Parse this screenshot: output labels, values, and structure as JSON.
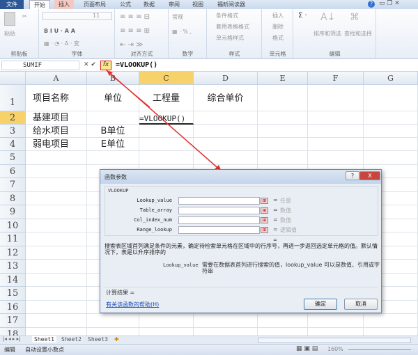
{
  "ribbon_tabs": [
    "文件",
    "开始",
    "插入",
    "页面布局",
    "公式",
    "数据",
    "审阅",
    "视图",
    "福昕阅读器"
  ],
  "ribbon": {
    "clipboard": {
      "paste": "粘贴",
      "label": "剪贴板"
    },
    "font": {
      "size": "11",
      "label": "字体"
    },
    "alignment": {
      "label": "对齐方式"
    },
    "number": {
      "format": "常规",
      "label": "数字"
    },
    "styles": {
      "cond": "条件格式",
      "table": "套用表格格式",
      "cell": "单元格样式",
      "label": "样式"
    },
    "cells": {
      "insert": "插入",
      "delete": "删除",
      "format": "格式",
      "label": "单元格"
    },
    "editing": {
      "sort": "排序和筛选",
      "find": "查找和选择",
      "label": "编辑"
    }
  },
  "formula_bar": {
    "name_box": "SUMIF",
    "fx": "fx",
    "formula": "=VLOOKUP()"
  },
  "columns": [
    "A",
    "B",
    "C",
    "D",
    "E",
    "F",
    "G"
  ],
  "rows": [
    "1",
    "2",
    "3",
    "4",
    "5",
    "6",
    "7",
    "8",
    "9",
    "10",
    "11",
    "12",
    "13",
    "14",
    "15",
    "16",
    "17",
    "18"
  ],
  "cells": {
    "A1": "项目名称",
    "B1": "单位",
    "C1": "工程量",
    "D1": "综合单价",
    "A2": "基建项目",
    "C2": "=VLOOKUP()",
    "A3": "给水项目",
    "B3": "B单位",
    "A4": "弱电项目",
    "B4": "E单位"
  },
  "dialog": {
    "title": "函数参数",
    "function": "VLOOKUP",
    "args": [
      {
        "name": "Lookup_value",
        "value": "",
        "result": "任意"
      },
      {
        "name": "Table_array",
        "value": "",
        "result": "数值"
      },
      {
        "name": "Col_index_num",
        "value": "",
        "result": "数值"
      },
      {
        "name": "Range_lookup",
        "value": "",
        "result": "逻辑值"
      }
    ],
    "eq": "=",
    "description": "搜索表区域首列满足条件的元素，确定待检索单元格在区域中的行序号，再进一步返回选定单元格的值。默认情况下，表是以升序排序的",
    "arg_help_name": "Lookup_value",
    "arg_help": "需要在数据表首列进行搜索的值，lookup_value 可以是数值、引用或字符串",
    "result_label": "计算结果 =",
    "help_link": "有关该函数的帮助(H)",
    "ok": "确定",
    "cancel": "取消",
    "help_icon": "?",
    "close_icon": "X"
  },
  "sheet_tabs": [
    "Sheet1",
    "Sheet2",
    "Sheet3"
  ],
  "status": {
    "mode": "编辑",
    "auto_decimal": "自动设置小数点",
    "zoom": "160%"
  }
}
